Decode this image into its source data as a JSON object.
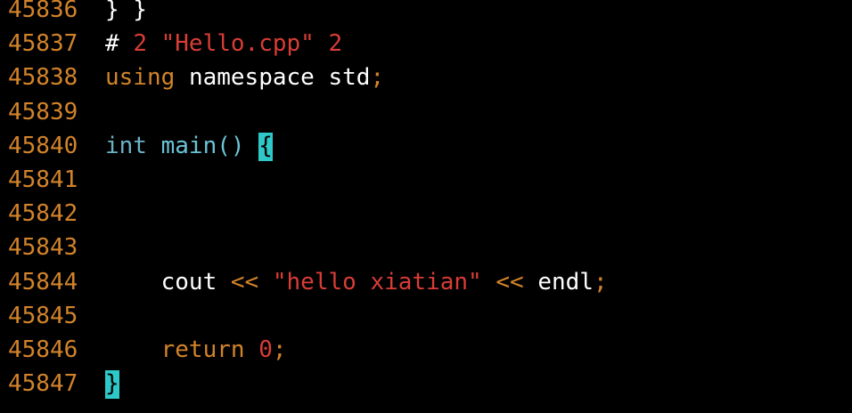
{
  "colors": {
    "background": "#000000",
    "line_number": "#d2832a",
    "keyword": "#d2832a",
    "type": "#6bb3c7",
    "function": "#6bc4d6",
    "string": "#d83d36",
    "number": "#d83d36",
    "text": "#ffffff",
    "brace_highlight": "#2ec8c8"
  },
  "lines": [
    {
      "number": "45836",
      "tokens": [
        "} }"
      ]
    },
    {
      "number": "45837",
      "tokens": [
        "# ",
        "2",
        " ",
        "\"Hello.cpp\"",
        " ",
        "2"
      ]
    },
    {
      "number": "45838",
      "tokens": [
        "using",
        " ",
        "namespace std",
        ";"
      ]
    },
    {
      "number": "45839",
      "tokens": []
    },
    {
      "number": "45840",
      "tokens": [
        "int",
        " ",
        "main()",
        " ",
        "{"
      ]
    },
    {
      "number": "45841",
      "tokens": []
    },
    {
      "number": "45842",
      "tokens": []
    },
    {
      "number": "45843",
      "tokens": []
    },
    {
      "number": "45844",
      "tokens": [
        "    ",
        "cout",
        " ",
        "<<",
        " ",
        "\"hello xiatian\"",
        " ",
        "<<",
        " ",
        "endl",
        ";"
      ]
    },
    {
      "number": "45845",
      "tokens": []
    },
    {
      "number": "45846",
      "tokens": [
        "    ",
        "return",
        " ",
        "0",
        ";"
      ]
    },
    {
      "number": "45847",
      "tokens": [
        "}"
      ]
    }
  ]
}
